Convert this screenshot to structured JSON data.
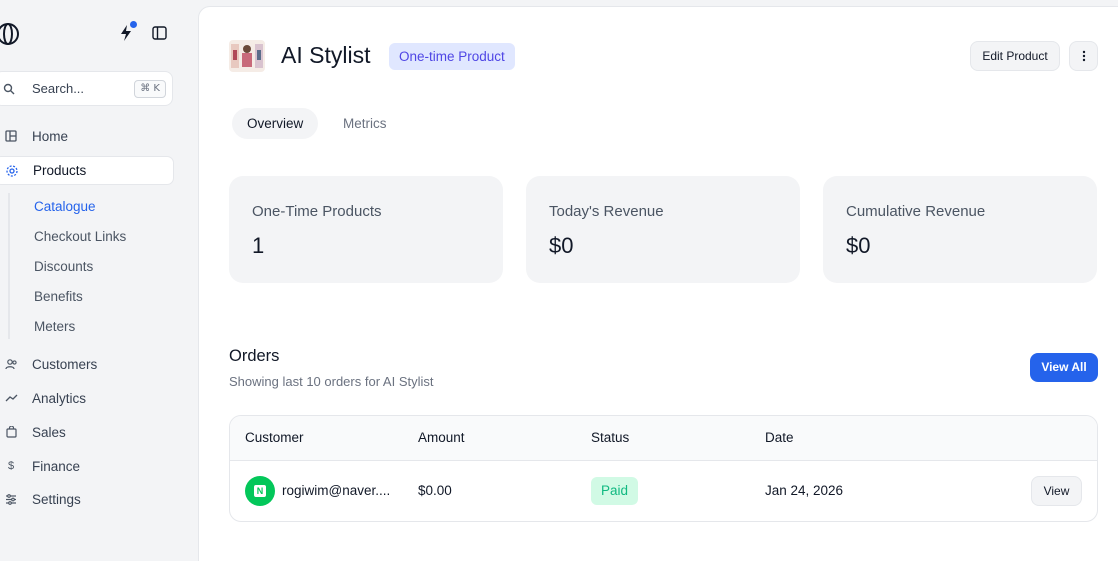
{
  "sidebar": {
    "search": {
      "placeholder": "Search...",
      "shortcut": "⌘ K"
    },
    "items": [
      {
        "label": "Home",
        "icon": "home-icon"
      },
      {
        "label": "Products",
        "icon": "products-icon"
      },
      {
        "label": "Customers",
        "icon": "customers-icon"
      },
      {
        "label": "Analytics",
        "icon": "analytics-icon"
      },
      {
        "label": "Sales",
        "icon": "sales-icon"
      },
      {
        "label": "Finance",
        "icon": "finance-icon"
      },
      {
        "label": "Settings",
        "icon": "settings-icon"
      }
    ],
    "subitems": [
      {
        "label": "Catalogue"
      },
      {
        "label": "Checkout Links"
      },
      {
        "label": "Discounts"
      },
      {
        "label": "Benefits"
      },
      {
        "label": "Meters"
      }
    ]
  },
  "header": {
    "title": "AI Stylist",
    "badge": "One-time Product",
    "edit_label": "Edit Product"
  },
  "tabs": [
    {
      "label": "Overview"
    },
    {
      "label": "Metrics"
    }
  ],
  "cards": [
    {
      "label": "One-Time Products",
      "value": "1"
    },
    {
      "label": "Today's Revenue",
      "value": "$0"
    },
    {
      "label": "Cumulative Revenue",
      "value": "$0"
    }
  ],
  "orders": {
    "title": "Orders",
    "subtitle": "Showing last 10 orders for AI Stylist",
    "view_all_label": "View All",
    "columns": [
      "Customer",
      "Amount",
      "Status",
      "Date"
    ],
    "rows": [
      {
        "customer": "rogiwim@naver....",
        "amount": "$0.00",
        "status": "Paid",
        "date": "Jan 24, 2026",
        "action": "View"
      }
    ]
  },
  "colors": {
    "accent": "#2563eb",
    "badge_bg": "#e0e7ff",
    "paid_bg": "#d1fae5",
    "paid_text": "#10b981",
    "naver_green": "#03c75a"
  }
}
